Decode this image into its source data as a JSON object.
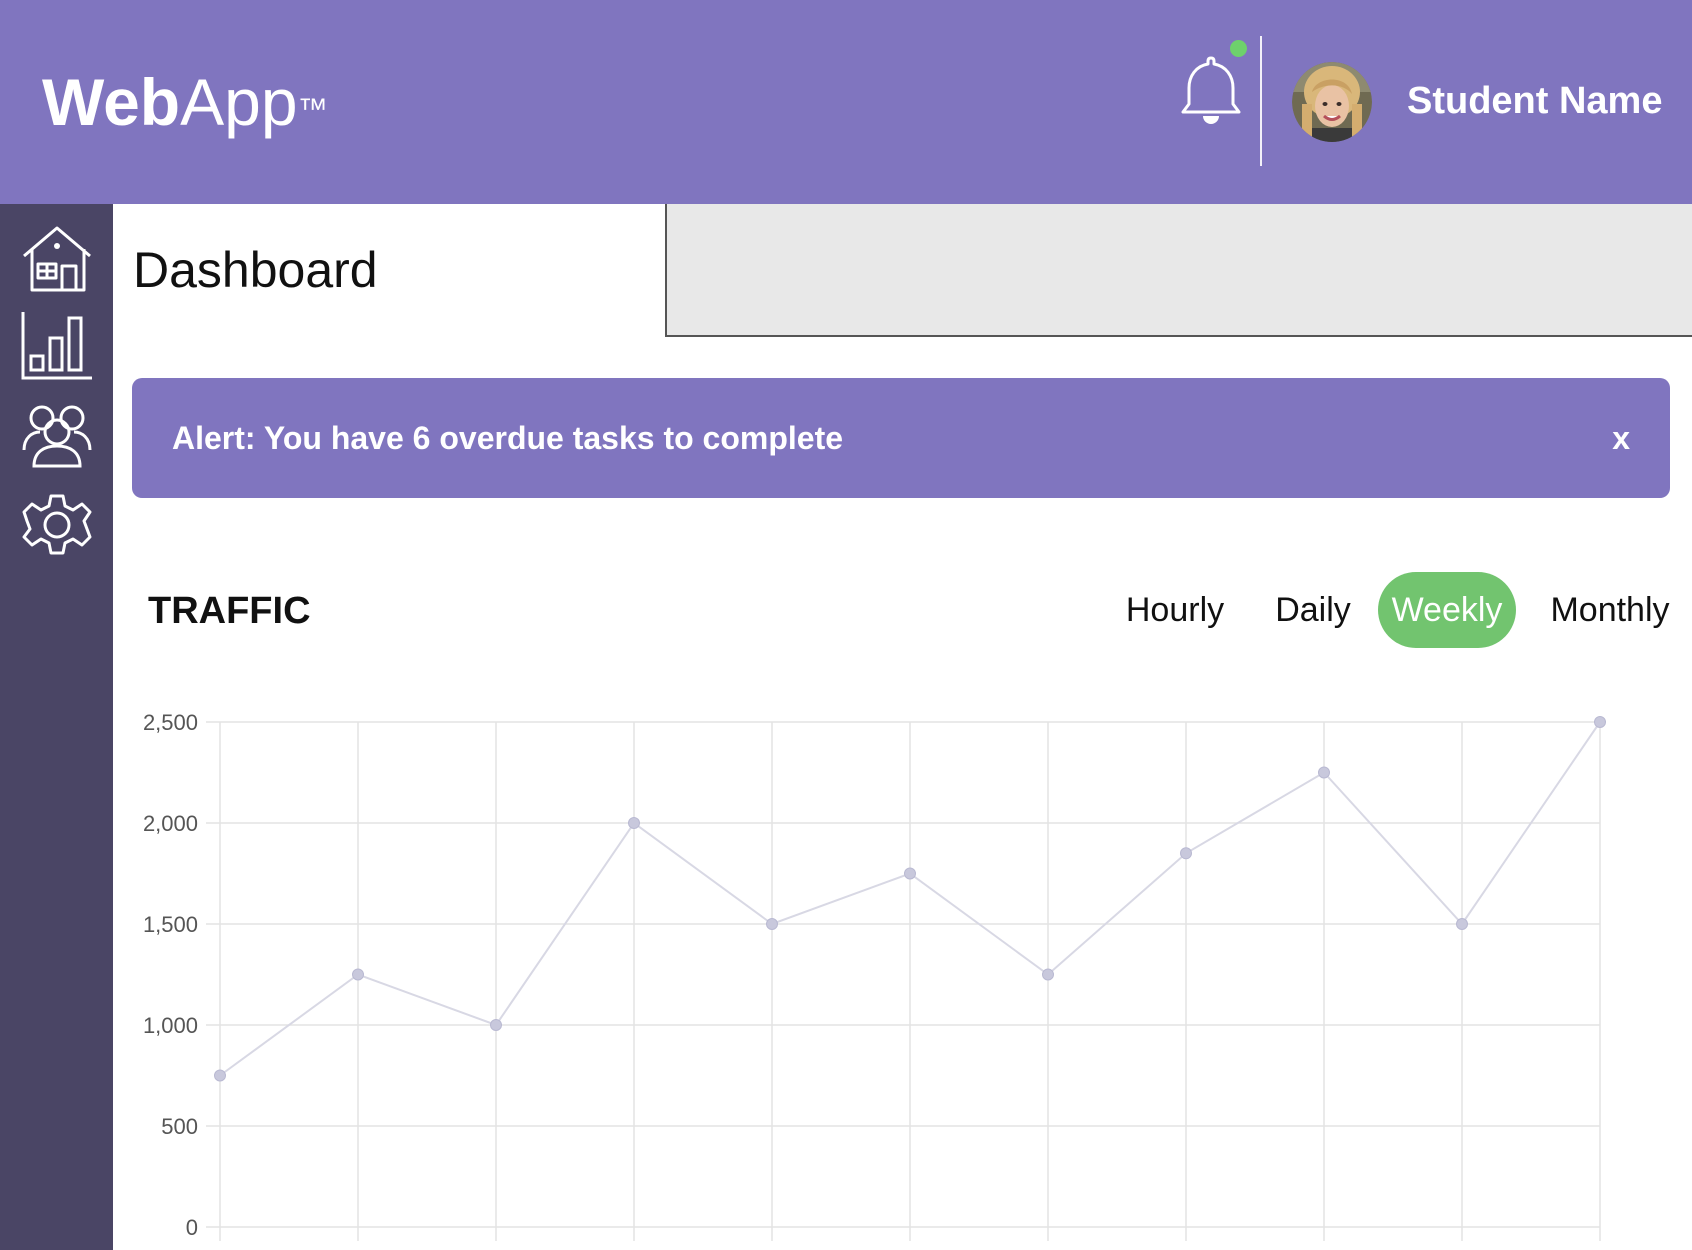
{
  "header": {
    "logo_bold": "Web",
    "logo_rest": "App",
    "logo_tm": "™",
    "username": "Student Name",
    "notification_indicator_color": "#6ed16c",
    "bell_icon": "bell-icon",
    "avatar_icon": "user-avatar"
  },
  "sidebar": {
    "items": [
      {
        "icon": "home-icon"
      },
      {
        "icon": "bar-chart-icon"
      },
      {
        "icon": "users-icon"
      },
      {
        "icon": "gear-icon"
      }
    ]
  },
  "main": {
    "title": "Dashboard"
  },
  "alert": {
    "message": "Alert: You have 6 overdue tasks to complete",
    "close_label": "x"
  },
  "traffic": {
    "title": "TRAFFIC",
    "tabs": [
      {
        "label": "Hourly",
        "active": false
      },
      {
        "label": "Daily",
        "active": false
      },
      {
        "label": "Weekly",
        "active": true
      },
      {
        "label": "Monthly",
        "active": false
      }
    ]
  },
  "colors": {
    "brand": "#8075bf",
    "sidebar": "#4a4565",
    "active_tab": "#72c46f"
  },
  "chart_data": {
    "type": "line",
    "x": [
      1,
      2,
      3,
      4,
      5,
      6,
      7,
      8,
      9,
      10,
      11
    ],
    "values": [
      750,
      1250,
      1000,
      2000,
      1500,
      1750,
      1250,
      1850,
      2250,
      1500,
      2500
    ],
    "ylim": [
      0,
      2500
    ],
    "yticks": [
      "2,500",
      "2,000",
      "1,500",
      "1,000",
      "500",
      "0"
    ],
    "ytick_values": [
      2500,
      2000,
      1500,
      1000,
      500,
      0
    ],
    "grid": true,
    "line_color": "#d8d8e4",
    "point_color": "#c8c8dc"
  }
}
